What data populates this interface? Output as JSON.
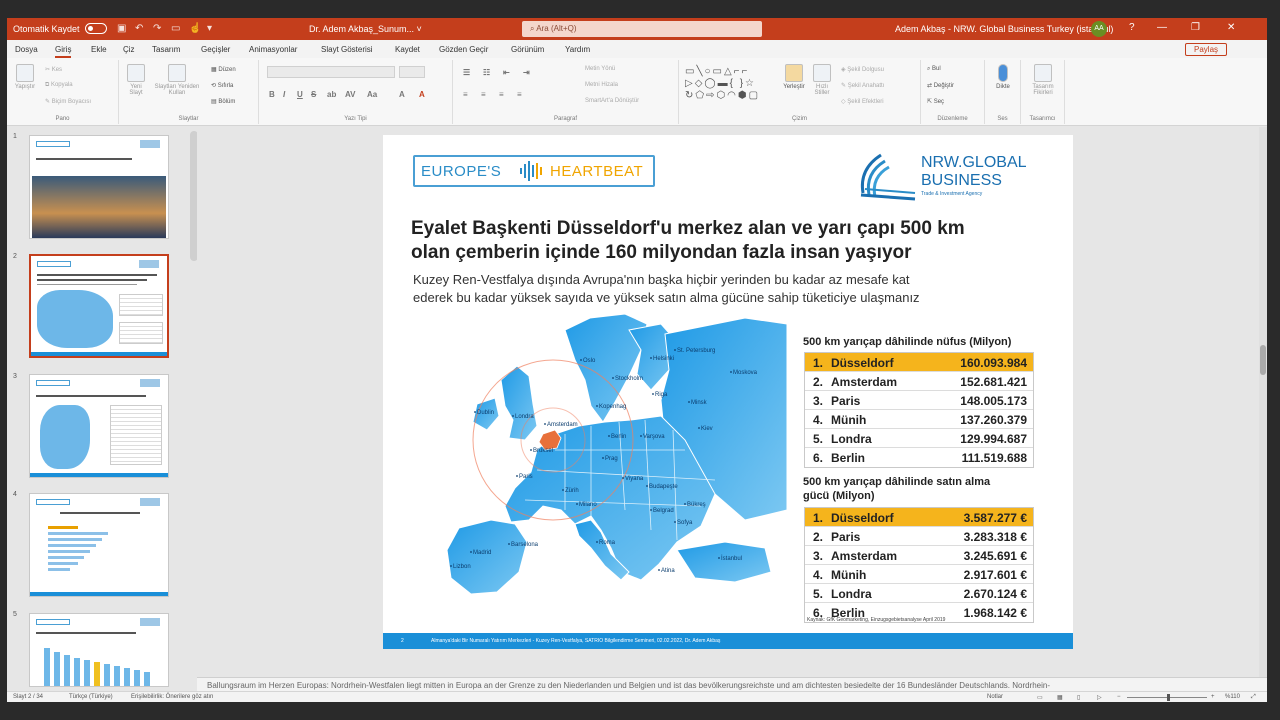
{
  "titlebar": {
    "autosave": "Otomatik Kaydet",
    "doc_title": "Dr. Adem Akbaş_Sunum... ˅",
    "search_placeholder": "Ara (Alt+Q)",
    "user": "Adem Akbaş - NRW. Global Business Turkey (istanbul)",
    "avatar": "AA",
    "minimize": "—",
    "restore": "❐",
    "close": "✕"
  },
  "tabs": [
    "Dosya",
    "Giriş",
    "Ekle",
    "Çiz",
    "Tasarım",
    "Geçişler",
    "Animasyonlar",
    "Slayt Gösterisi",
    "Kaydet",
    "Gözden Geçir",
    "Görünüm",
    "Yardım"
  ],
  "share": "Paylaş",
  "ribbon": {
    "paste": "Yapıştır",
    "cut": "Kes",
    "copy": "Kopyala",
    "format_painter": "Biçim Boyacısı",
    "clipboard": "Pano",
    "new_slide": "Yeni Slayt",
    "reuse_slides": "Slaytları Yeniden Kullan",
    "layout": "Düzen",
    "reset": "Sıfırla",
    "section": "Bölüm",
    "slides": "Slaytlar",
    "font": "Yazı Tipi",
    "paragraph": "Paragraf",
    "text_direction": "Metin Yönü",
    "align_text": "Metni Hizala",
    "smartart": "SmartArt'a Dönüştür",
    "arrange": "Yerleştir",
    "quick_styles": "Hızlı Stiller",
    "shape_fill": "Şekil Dolgusu",
    "shape_outline": "Şekil Anahattı",
    "shape_effects": "Şekil Efektleri",
    "drawing": "Çizim",
    "find": "Bul",
    "replace": "Değiştir",
    "select": "Seç",
    "editing": "Düzenleme",
    "dictate": "Dikte",
    "voice": "Ses",
    "designer": "Tasarım Fikirleri",
    "designer_group": "Tasarımcı",
    "font_buttons": [
      "B",
      "I",
      "U",
      "S",
      "ab",
      "AV",
      "Aa",
      "A",
      "A"
    ]
  },
  "thumbnails": [
    "1",
    "2",
    "3",
    "4",
    "5"
  ],
  "slide": {
    "logo_left_a": "EUROPE'S",
    "logo_left_b": "HEARTBEAT",
    "logo_right_a": "NRW.GLOBAL",
    "logo_right_b": "BUSINESS",
    "logo_right_tag": "Trade & Investment Agency",
    "headline_1": "Eyalet Başkenti Düsseldorf'u merkez alan ve yarı çapı 500 km",
    "headline_2": "olan çemberin içinde 160 milyondan fazla insan yaşıyor",
    "sub_1": "Kuzey Ren-Vestfalya dışında Avrupa'nın başka hiçbir yerinden bu kadar az mesafe kat",
    "sub_2": "ederek bu kadar yüksek sayıda ve yüksek satın alma gücüne sahip tüketiciye ulaşmanız",
    "map_labels": [
      "St. Petersburg",
      "Moskova",
      "Kiev",
      "Londra",
      "Paris",
      "Berlin",
      "Varşova",
      "Roma",
      "Madrid",
      "İstanbul",
      "Viyana",
      "Kopenhag",
      "Stockholm",
      "Oslo",
      "Helsinki",
      "Prag",
      "Budapeşte",
      "Bükreş",
      "Atina",
      "Minsk",
      "Riga",
      "Dublin",
      "Lizbon",
      "Barselona",
      "Milano",
      "Amsterdam",
      "Brüksel",
      "Zürih",
      "Sofya",
      "Belgrad"
    ],
    "table1_title": "500 km yarıçap dâhilinde nüfus (Milyon)",
    "table1": [
      {
        "rank": "1.",
        "city": "Düsseldorf",
        "value": "160.093.984",
        "highlight": true
      },
      {
        "rank": "2.",
        "city": "Amsterdam",
        "value": "152.681.421",
        "highlight": false
      },
      {
        "rank": "3.",
        "city": "Paris",
        "value": "148.005.173",
        "highlight": false
      },
      {
        "rank": "4.",
        "city": "Münih",
        "value": "137.260.379",
        "highlight": false
      },
      {
        "rank": "5.",
        "city": "Londra",
        "value": "129.994.687",
        "highlight": false
      },
      {
        "rank": "6.",
        "city": "Berlin",
        "value": "111.519.688",
        "highlight": false
      }
    ],
    "table2_title_1": "500 km yarıçap dâhilinde satın alma",
    "table2_title_2": "gücü (Milyon)",
    "table2": [
      {
        "rank": "1.",
        "city": "Düsseldorf",
        "value": "3.587.277 €",
        "highlight": true
      },
      {
        "rank": "2.",
        "city": "Paris",
        "value": "3.283.318 €",
        "highlight": false
      },
      {
        "rank": "3.",
        "city": "Amsterdam",
        "value": "3.245.691 €",
        "highlight": false
      },
      {
        "rank": "4.",
        "city": "Münih",
        "value": "2.917.601 €",
        "highlight": false
      },
      {
        "rank": "5.",
        "city": "Londra",
        "value": "2.670.124 €",
        "highlight": false
      },
      {
        "rank": "6.",
        "city": "Berlin",
        "value": "1.968.142 €",
        "highlight": false
      }
    ],
    "source": "Kaynak: GfK Geomarketing, Einzugsgebietsanalyse April 2019",
    "footer_num": "2",
    "footer_text": "Almanya'daki Bir Numaralı Yatırım Merkezleri - Kuzey Ren-Vestfalya, SATRIO Bilgilendirme Semineri, 02.02.2022, Dr. Adem Akbaş"
  },
  "notes": "Ballungsraum im Herzen Europas: Nordrhein-Westfalen liegt mitten in Europa an der Grenze zu den Niederlanden und Belgien und ist das bevölkerungsreichste und am dichtesten besiedelte der 16 Bundesländer Deutschlands. Nordrhein-",
  "status": {
    "slide": "Slayt 2 / 34",
    "language": "Türkçe (Türkiye)",
    "accessibility": "Erişilebilirlik: Önerilere göz atın",
    "notes": "Notlar",
    "zoom": "%110"
  },
  "colors": {
    "accent": "#c43e1c",
    "brand_blue": "#1a8fd8",
    "highlight": "#f5b41c"
  }
}
